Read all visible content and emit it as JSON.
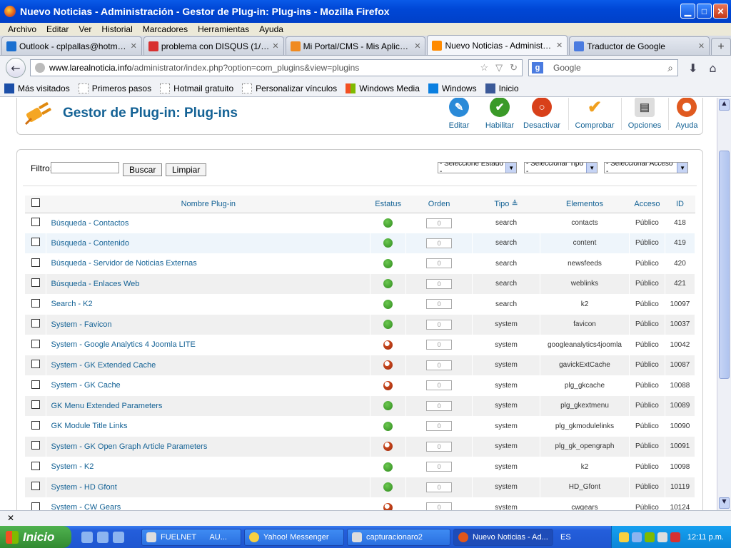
{
  "window": {
    "title": "Nuevo Noticias - Administración - Gestor de Plug-in: Plug-ins - Mozilla Firefox"
  },
  "menu": [
    "Archivo",
    "Editar",
    "Ver",
    "Historial",
    "Marcadores",
    "Herramientas",
    "Ayuda"
  ],
  "tabs": [
    {
      "label": "Outlook - cplpallas@hotmail.c...",
      "color": "#1a6fd0"
    },
    {
      "label": "problema con DISQUS (1/1) - ...",
      "color": "#d83030"
    },
    {
      "label": "Mi Portal/CMS - Mis Aplicacion...",
      "color": "#f08a20"
    },
    {
      "label": "Nuevo Noticias - Administració...",
      "color": "#ff8a00",
      "active": true
    },
    {
      "label": "Traductor de Google",
      "color": "#4a7be0"
    }
  ],
  "url": {
    "domain": "www.larealnoticia.info",
    "path": "/administrator/index.php?option=com_plugins&view=plugins"
  },
  "search": {
    "placeholder": "Google"
  },
  "bookmarks": [
    "Más visitados",
    "Primeros pasos",
    "Hotmail gratuito",
    "Personalizar vínculos",
    "Windows Media",
    "Windows",
    "Inicio"
  ],
  "page": {
    "title": "Gestor de Plug-in: Plug-ins",
    "toolbar": [
      {
        "label": "Editar",
        "color": "#2a8ad8",
        "glyph": "✎"
      },
      {
        "label": "Habilitar",
        "color": "#3a9a28",
        "glyph": "✔"
      },
      {
        "label": "Desactivar",
        "color": "#d8401a",
        "glyph": "○"
      },
      {
        "label": "Comprobar",
        "color": "#f0a020",
        "glyph": "✔"
      },
      {
        "label": "Opciones",
        "color": "#c8c8c8",
        "glyph": "▤"
      },
      {
        "label": "Ayuda",
        "color": "#e05a20",
        "glyph": "✚"
      }
    ],
    "filter_label": "Filtro:",
    "buscar": "Buscar",
    "limpiar": "Limpiar",
    "selects": [
      "- Seleccione Estado -",
      "- Seleccionar Tipo -",
      "- Seleccionar Acceso -"
    ],
    "columns": [
      "Nombre Plug-in",
      "Estatus",
      "Orden",
      "Tipo",
      "Elementos",
      "Acceso",
      "ID"
    ],
    "rows": [
      {
        "name": "Búsqueda - Contactos",
        "status": "on",
        "order": "0",
        "type": "search",
        "element": "contacts",
        "access": "Público",
        "id": "418"
      },
      {
        "name": "Búsqueda - Contenido",
        "status": "on",
        "order": "0",
        "type": "search",
        "element": "content",
        "access": "Público",
        "id": "419"
      },
      {
        "name": "Búsqueda - Servidor de Noticias Externas",
        "status": "on",
        "order": "0",
        "type": "search",
        "element": "newsfeeds",
        "access": "Público",
        "id": "420"
      },
      {
        "name": "Búsqueda - Enlaces Web",
        "status": "on",
        "order": "0",
        "type": "search",
        "element": "weblinks",
        "access": "Público",
        "id": "421"
      },
      {
        "name": "Search - K2",
        "status": "on",
        "order": "0",
        "type": "search",
        "element": "k2",
        "access": "Público",
        "id": "10097"
      },
      {
        "name": "System - Favicon",
        "status": "on",
        "order": "0",
        "type": "system",
        "element": "favicon",
        "access": "Público",
        "id": "10037"
      },
      {
        "name": "System - Google Analytics 4 Joomla LITE",
        "status": "off",
        "order": "0",
        "type": "system",
        "element": "googleanalytics4joomla",
        "access": "Público",
        "id": "10042"
      },
      {
        "name": "System - GK Extended Cache",
        "status": "off",
        "order": "0",
        "type": "system",
        "element": "gavickExtCache",
        "access": "Público",
        "id": "10087"
      },
      {
        "name": "System - GK Cache",
        "status": "off",
        "order": "0",
        "type": "system",
        "element": "plg_gkcache",
        "access": "Público",
        "id": "10088"
      },
      {
        "name": "GK Menu Extended Parameters",
        "status": "on",
        "order": "0",
        "type": "system",
        "element": "plg_gkextmenu",
        "access": "Público",
        "id": "10089"
      },
      {
        "name": "GK Module Title Links",
        "status": "on",
        "order": "0",
        "type": "system",
        "element": "plg_gkmodulelinks",
        "access": "Público",
        "id": "10090"
      },
      {
        "name": "System - GK Open Graph Article Parameters",
        "status": "off",
        "order": "0",
        "type": "system",
        "element": "plg_gk_opengraph",
        "access": "Público",
        "id": "10091"
      },
      {
        "name": "System - K2",
        "status": "on",
        "order": "0",
        "type": "system",
        "element": "k2",
        "access": "Público",
        "id": "10098"
      },
      {
        "name": "System - HD Gfont",
        "status": "on",
        "order": "0",
        "type": "system",
        "element": "HD_Gfont",
        "access": "Público",
        "id": "10119"
      },
      {
        "name": "System - CW Gears",
        "status": "off",
        "order": "0",
        "type": "system",
        "element": "cwgears",
        "access": "Público",
        "id": "10124"
      }
    ]
  },
  "taskbar": {
    "start": "Inicio",
    "tasks": [
      "FUELNET",
      "AU...",
      "Yahoo! Messenger",
      "capturacionaro2",
      "Nuevo Noticias - Ad..."
    ],
    "lang": "ES",
    "clock": "12:11 p.m."
  }
}
